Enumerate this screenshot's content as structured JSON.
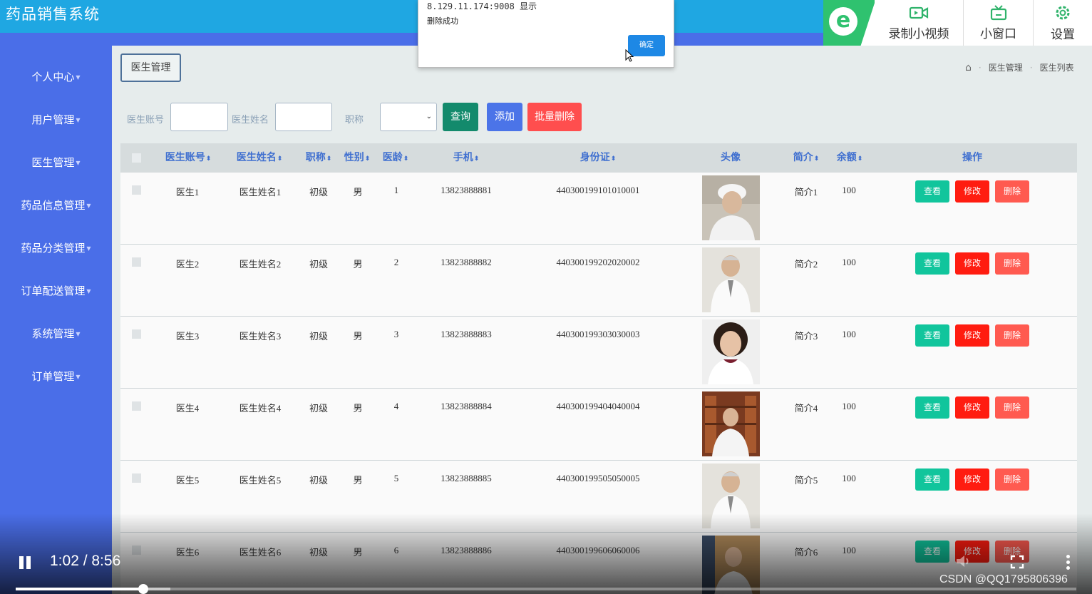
{
  "app": {
    "title": "药品销售系统"
  },
  "recorder": {
    "video_label": "录制小视频",
    "mini_label": "小窗口",
    "settings_label": "设置"
  },
  "sidebar": {
    "items": [
      {
        "label": "个人中心"
      },
      {
        "label": "用户管理"
      },
      {
        "label": "医生管理"
      },
      {
        "label": "药品信息管理"
      },
      {
        "label": "药品分类管理"
      },
      {
        "label": "订单配送管理"
      },
      {
        "label": "系统管理"
      },
      {
        "label": "订单管理"
      }
    ]
  },
  "page": {
    "tab_label": "医生管理",
    "breadcrumb": [
      "医生管理",
      "医生列表"
    ]
  },
  "filters": {
    "account_label": "医生账号",
    "name_label": "医生姓名",
    "title_label": "职称",
    "account_value": "",
    "name_value": "",
    "title_value": "",
    "query_label": "查询",
    "add_label": "添加",
    "batch_delete_label": "批量删除"
  },
  "table": {
    "headers": {
      "account": "医生账号",
      "name": "医生姓名",
      "title": "职称",
      "gender": "性别",
      "seniority": "医龄",
      "phone": "手机",
      "id_card": "身份证",
      "avatar": "头像",
      "intro": "简介",
      "balance": "余额",
      "actions": "操作"
    },
    "action_labels": {
      "view": "查看",
      "edit": "修改",
      "delete": "删除"
    },
    "rows": [
      {
        "account": "医生1",
        "name": "医生姓名1",
        "title": "初级",
        "gender": "男",
        "seniority": "1",
        "phone": "13823888881",
        "id_card": "440300199101010001",
        "intro": "简介1",
        "balance": "100"
      },
      {
        "account": "医生2",
        "name": "医生姓名2",
        "title": "初级",
        "gender": "男",
        "seniority": "2",
        "phone": "13823888882",
        "id_card": "440300199202020002",
        "intro": "简介2",
        "balance": "100"
      },
      {
        "account": "医生3",
        "name": "医生姓名3",
        "title": "初级",
        "gender": "男",
        "seniority": "3",
        "phone": "13823888883",
        "id_card": "440300199303030003",
        "intro": "简介3",
        "balance": "100"
      },
      {
        "account": "医生4",
        "name": "医生姓名4",
        "title": "初级",
        "gender": "男",
        "seniority": "4",
        "phone": "13823888884",
        "id_card": "440300199404040004",
        "intro": "简介4",
        "balance": "100"
      },
      {
        "account": "医生5",
        "name": "医生姓名5",
        "title": "初级",
        "gender": "男",
        "seniority": "5",
        "phone": "13823888885",
        "id_card": "440300199505050005",
        "intro": "简介5",
        "balance": "100"
      },
      {
        "account": "医生6",
        "name": "医生姓名6",
        "title": "初级",
        "gender": "男",
        "seniority": "6",
        "phone": "13823888886",
        "id_card": "440300199606060006",
        "intro": "简介6",
        "balance": "100"
      }
    ]
  },
  "dialog": {
    "title": "8.129.11.174:9008 显示",
    "message": "删除成功",
    "ok_label": "确定"
  },
  "player": {
    "time": "1:02 / 8:56",
    "played_fraction": 0.12,
    "buffered_fraction": 0.146,
    "watermark": "CSDN @QQ1795806396"
  }
}
